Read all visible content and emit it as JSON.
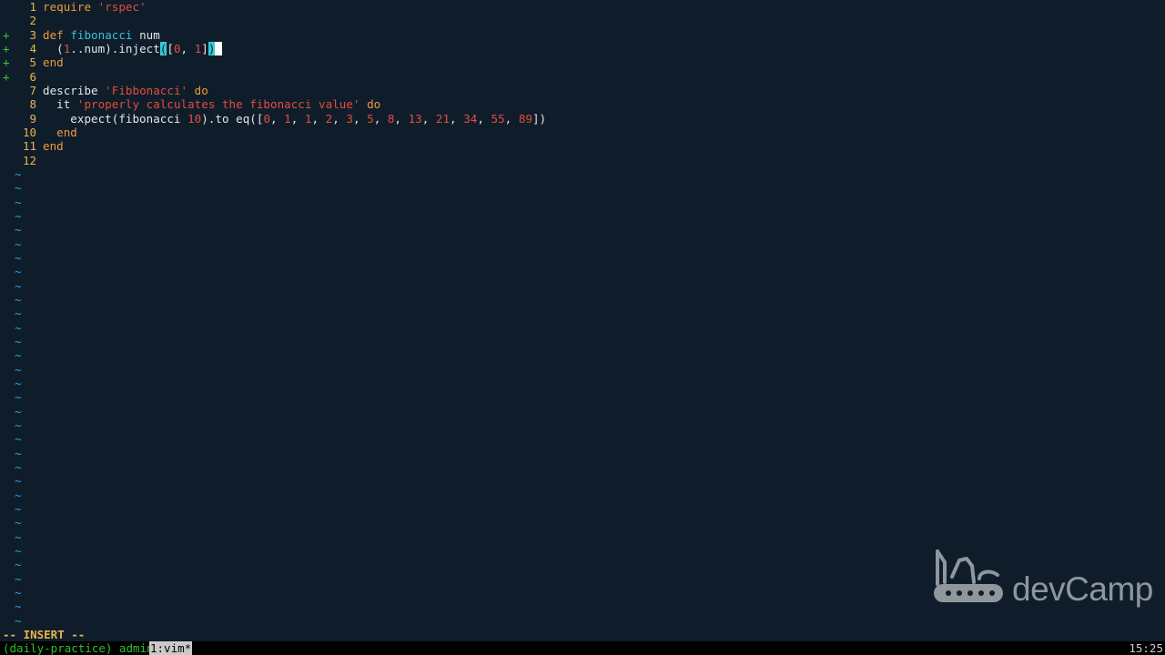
{
  "editor": {
    "lines": [
      {
        "n": "1",
        "sign": "",
        "segments": [
          {
            "t": "require ",
            "c": "kw"
          },
          {
            "t": "'rspec'",
            "c": "str"
          }
        ]
      },
      {
        "n": "2",
        "sign": "",
        "segments": []
      },
      {
        "n": "3",
        "sign": "+",
        "segments": [
          {
            "t": "def ",
            "c": "kw"
          },
          {
            "t": "fibonacci",
            "c": "fn"
          },
          {
            "t": " num",
            "c": "plain"
          }
        ]
      },
      {
        "n": "4",
        "sign": "+",
        "segments": [
          {
            "t": "  (",
            "c": "plain"
          },
          {
            "t": "1",
            "c": "num"
          },
          {
            "t": "..num).inject",
            "c": "plain"
          },
          {
            "t": "(",
            "c": "paren-hl"
          },
          {
            "t": "[",
            "c": "plain"
          },
          {
            "t": "0",
            "c": "num"
          },
          {
            "t": ", ",
            "c": "plain"
          },
          {
            "t": "1",
            "c": "num"
          },
          {
            "t": "]",
            "c": "plain"
          },
          {
            "t": ")",
            "c": "paren-hl"
          },
          {
            "t": " ",
            "c": "cursor"
          }
        ]
      },
      {
        "n": "5",
        "sign": "+",
        "segments": [
          {
            "t": "end",
            "c": "kw"
          }
        ]
      },
      {
        "n": "6",
        "sign": "+",
        "segments": []
      },
      {
        "n": "7",
        "sign": "",
        "segments": [
          {
            "t": "describe ",
            "c": "plain"
          },
          {
            "t": "'Fibbonacci'",
            "c": "str"
          },
          {
            "t": " do",
            "c": "kw"
          }
        ]
      },
      {
        "n": "8",
        "sign": "",
        "segments": [
          {
            "t": "  it ",
            "c": "plain"
          },
          {
            "t": "'properly calculates the fibonacci value'",
            "c": "str"
          },
          {
            "t": " do",
            "c": "kw"
          }
        ]
      },
      {
        "n": "9",
        "sign": "",
        "segments": [
          {
            "t": "    expect(fibonacci ",
            "c": "plain"
          },
          {
            "t": "10",
            "c": "num"
          },
          {
            "t": ").to eq([",
            "c": "plain"
          },
          {
            "t": "0",
            "c": "num"
          },
          {
            "t": ", ",
            "c": "plain"
          },
          {
            "t": "1",
            "c": "num"
          },
          {
            "t": ", ",
            "c": "plain"
          },
          {
            "t": "1",
            "c": "num"
          },
          {
            "t": ", ",
            "c": "plain"
          },
          {
            "t": "2",
            "c": "num"
          },
          {
            "t": ", ",
            "c": "plain"
          },
          {
            "t": "3",
            "c": "num"
          },
          {
            "t": ", ",
            "c": "plain"
          },
          {
            "t": "5",
            "c": "num"
          },
          {
            "t": ", ",
            "c": "plain"
          },
          {
            "t": "8",
            "c": "num"
          },
          {
            "t": ", ",
            "c": "plain"
          },
          {
            "t": "13",
            "c": "num"
          },
          {
            "t": ", ",
            "c": "plain"
          },
          {
            "t": "21",
            "c": "num"
          },
          {
            "t": ", ",
            "c": "plain"
          },
          {
            "t": "34",
            "c": "num"
          },
          {
            "t": ", ",
            "c": "plain"
          },
          {
            "t": "55",
            "c": "num"
          },
          {
            "t": ", ",
            "c": "plain"
          },
          {
            "t": "89",
            "c": "num"
          },
          {
            "t": "])",
            "c": "plain"
          }
        ]
      },
      {
        "n": "10",
        "sign": "",
        "segments": [
          {
            "t": "  end",
            "c": "kw"
          }
        ]
      },
      {
        "n": "11",
        "sign": "",
        "segments": [
          {
            "t": "end",
            "c": "kw"
          }
        ]
      },
      {
        "n": "12",
        "sign": "",
        "segments": []
      }
    ],
    "tilde": "~",
    "tilde_count": 33
  },
  "mode_label": "-- INSERT --",
  "statusbar": {
    "session": "(daily-practice) admin",
    "window": "1:vim*",
    "time": "15:25"
  },
  "watermark": {
    "text": "devCamp",
    "icon": "swiss-army-knife-icon"
  },
  "colors": {
    "background": "#0f1d2b",
    "keyword": "#ef9b3a",
    "function": "#3bc3d6",
    "string": "#e44c3c",
    "line_number": "#e9b44a",
    "git_sign": "#3cc23c",
    "tilde": "#2f9fe0"
  }
}
